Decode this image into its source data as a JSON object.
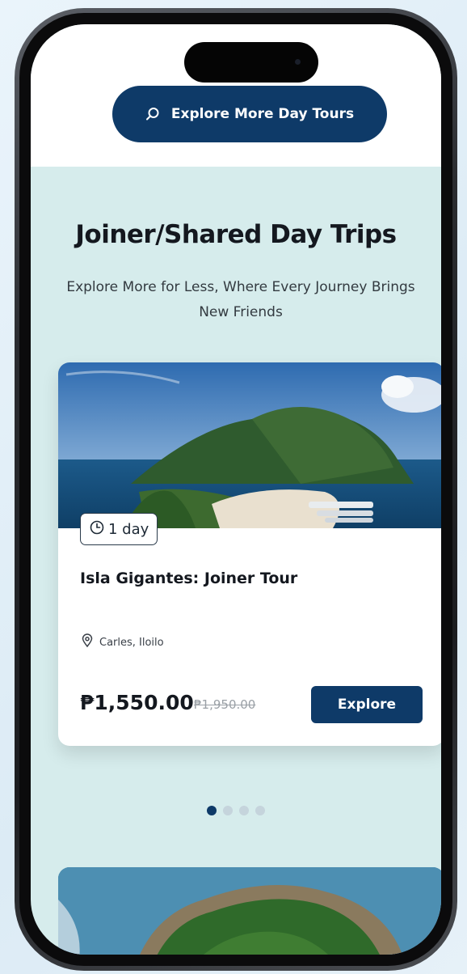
{
  "header": {
    "search_button_label": "Explore More Day Tours"
  },
  "section": {
    "title": "Joiner/Shared Day Trips",
    "subtitle": "Explore More for Less, Where Every Journey Brings New Friends"
  },
  "tour_card": {
    "duration": "1 day",
    "title": "Isla Gigantes: Joiner Tour",
    "location": "Carles, Iloilo",
    "price": "₱1,550.00",
    "original_price": "₱1,950.00",
    "explore_label": "Explore"
  },
  "carousel": {
    "total_slides": 4,
    "active_index": 0
  },
  "colors": {
    "primary": "#0e3a68",
    "section_bg": "#d6ecec",
    "text_dark": "#14181f"
  },
  "icons": [
    "search-icon",
    "clock-icon",
    "location-pin-icon"
  ]
}
